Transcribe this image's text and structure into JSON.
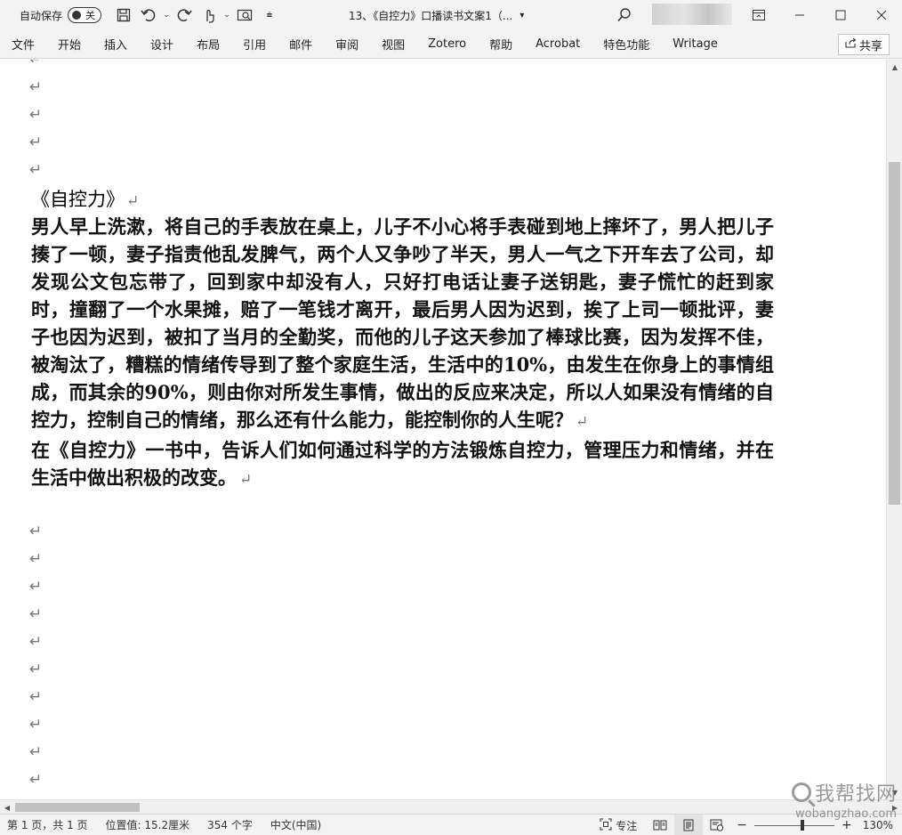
{
  "titlebar": {
    "autosave_label": "自动保存",
    "autosave_state": "关",
    "doc_title": "13、《自控力》口播读书文案1（...",
    "icons": [
      "save-icon",
      "undo-icon",
      "redo-icon",
      "touch-mode-icon",
      "print-preview-icon",
      "customize-icon",
      "search-icon",
      "ribbon-display-icon",
      "minimize-icon",
      "maximize-icon",
      "close-icon"
    ]
  },
  "ribbon": {
    "tabs": [
      "文件",
      "开始",
      "插入",
      "设计",
      "布局",
      "引用",
      "邮件",
      "审阅",
      "视图",
      "Zotero",
      "帮助",
      "Acrobat",
      "特色功能",
      "Writage"
    ],
    "share_label": "共享"
  },
  "document": {
    "pilcrow": "↵",
    "heading": "《自控力》",
    "paragraphs": [
      "男人早上洗漱，将自己的手表放在桌上，儿子不小心将手表碰到地上摔坏了，男人把儿子揍了一顿，妻子指责他乱发脾气，两个人又争吵了半天，男人一气之下开车去了公司，却发现公文包忘带了，回到家中却没有人，只好打电话让妻子送钥匙，妻子慌忙的赶到家时，撞翻了一个水果摊，赔了一笔钱才离开，最后男人因为迟到，挨了上司一顿批评，妻子也因为迟到，被扣了当月的全勤奖，而他的儿子这天参加了棒球比赛，因为发挥不佳，被淘汰了，糟糕的情绪传导到了整个家庭生活，生活中的10%，由发生在你身上的事情组成，而其余的90%，则由你对所发生事情，做出的反应来决定，所以人如果没有情绪的自控力，控制自己的情绪，那么还有什么能力，能控制你的人生呢？",
      "在《自控力》一书中，告诉人们如何通过科学的方法锻炼自控力，管理压力和情绪，并在生活中做出积极的改变。"
    ]
  },
  "statusbar": {
    "page": "第 1 页，共 1 页",
    "position": "位置值: 15.2厘米",
    "word_count": "354 个字",
    "language": "中文(中国)",
    "focus_label": "专注",
    "zoom_minus": "−",
    "zoom_plus": "+",
    "zoom": "130%"
  },
  "watermark": {
    "main": "我帮找网",
    "sub": "wobangzhao.com"
  }
}
